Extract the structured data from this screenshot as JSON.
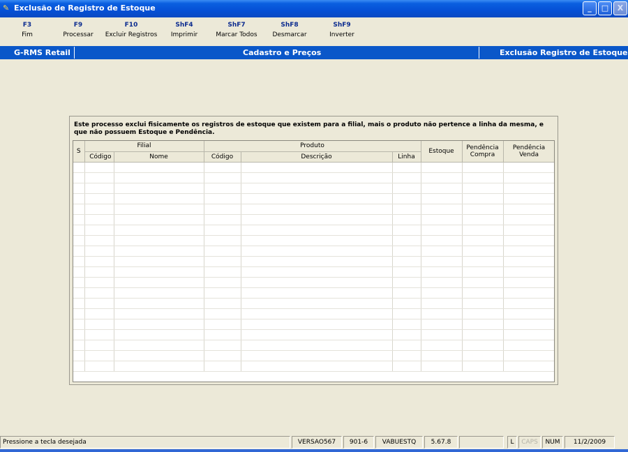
{
  "window": {
    "title": "Exclusão de Registro de Estoque",
    "controls": {
      "minimize": "_",
      "maximize": "□",
      "close": "X"
    }
  },
  "toolbar": {
    "keys": [
      {
        "key": "F3",
        "label": "Fim"
      },
      {
        "key": "F9",
        "label": "Processar"
      },
      {
        "key": "F10",
        "label": "Excluir Registros"
      },
      {
        "key": "ShF4",
        "label": "Imprimir"
      },
      {
        "key": "ShF7",
        "label": "Marcar Todos"
      },
      {
        "key": "ShF8",
        "label": "Desmarcar"
      },
      {
        "key": "ShF9",
        "label": "Inverter"
      }
    ]
  },
  "header": {
    "app": "G-RMS Retail",
    "module": "Cadastro e Preços",
    "screen": "Exclusão Registro de Estoque"
  },
  "panel": {
    "description": "Este processo exclui fisicamente os registros de estoque que existem para a filial, mais o produto não pertence a linha da mesma, e que não possuem Estoque e Pendência."
  },
  "grid": {
    "col_s": "S",
    "group_filial": "Filial",
    "group_produto": "Produto",
    "col_estoque": "Estoque",
    "col_pend_compra_1": "Pendência",
    "col_pend_compra_2": "Compra",
    "col_pend_venda_1": "Pendência",
    "col_pend_venda_2": "Venda",
    "col_filial_codigo": "Código",
    "col_filial_nome": "Nome",
    "col_produto_codigo": "Código",
    "col_produto_descricao": "Descrição",
    "col_produto_linha": "Linha",
    "rows": []
  },
  "statusbar": {
    "message": "Pressione a tecla desejada",
    "version": "VERSAO567",
    "code": "901-6",
    "program": "VABUESTQ",
    "release": "5.67.8",
    "empty": "",
    "lock": "L",
    "caps": "CAPS",
    "num": "NUM",
    "date": "11/2/2009"
  }
}
